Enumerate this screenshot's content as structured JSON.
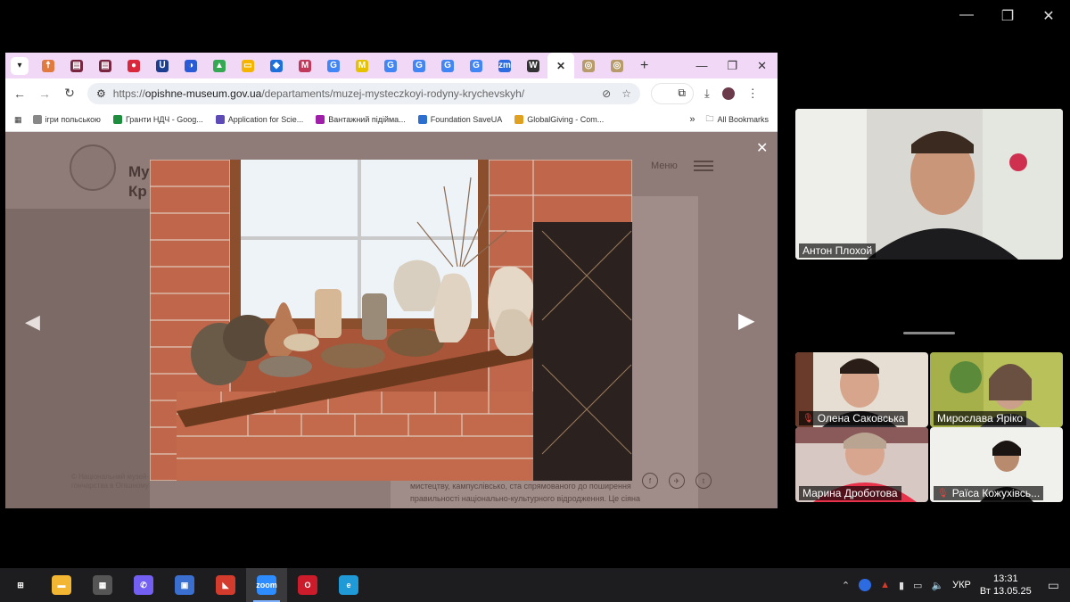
{
  "zoom_window": {
    "controls": [
      "—",
      "❐",
      "✕"
    ]
  },
  "browser": {
    "tabs": [
      {
        "glyph": "☨",
        "color": "#e07a3f"
      },
      {
        "glyph": "▤",
        "color": "#7a2540"
      },
      {
        "glyph": "▤",
        "color": "#7a2540"
      },
      {
        "glyph": "●",
        "color": "#d9283b"
      },
      {
        "glyph": "Ս",
        "color": "#1d3d8f"
      },
      {
        "glyph": "◑",
        "color": "#2a5bd7"
      },
      {
        "glyph": "▲",
        "color": "#34a853"
      },
      {
        "glyph": "▭",
        "color": "#f4b400"
      },
      {
        "glyph": "◆",
        "color": "#1e6fd9"
      },
      {
        "glyph": "M",
        "color": "#c0395a"
      },
      {
        "glyph": "G",
        "color": "#4285f4"
      },
      {
        "glyph": "M",
        "color": "#e5c100"
      },
      {
        "glyph": "G",
        "color": "#4285f4"
      },
      {
        "glyph": "G",
        "color": "#4285f4"
      },
      {
        "glyph": "G",
        "color": "#4285f4"
      },
      {
        "glyph": "G",
        "color": "#4285f4"
      },
      {
        "glyph": "zm",
        "color": "#2d6be0"
      },
      {
        "glyph": "W",
        "color": "#333333"
      }
    ],
    "active_tab_close": "✕",
    "tabs_after": [
      {
        "glyph": "◎",
        "color": "#b89b6a"
      },
      {
        "glyph": "◎",
        "color": "#b89b6a"
      }
    ],
    "new_tab": "+",
    "window_controls": [
      "—",
      "❐",
      "✕"
    ],
    "url": {
      "scheme": "https://",
      "host": "opishne-museum.gov.ua",
      "path": "/departaments/muzej-mystecz​koyi-rodyny-krychevskyh/"
    },
    "bookmarks": [
      {
        "label": "ігри польською",
        "color": "#888888",
        "type": "folder"
      },
      {
        "label": "Гранти НДЧ - Goog...",
        "color": "#1e8e3e"
      },
      {
        "label": "Application for Scie...",
        "color": "#5f4bb6"
      },
      {
        "label": "Вантажний підійма...",
        "color": "#a01fa8"
      },
      {
        "label": "Foundation SaveUA",
        "color": "#2c6fd1"
      },
      {
        "label": "GlobalGiving - Com...",
        "color": "#e0a020"
      }
    ],
    "bookmarks_more": "»",
    "all_bookmarks": "All Bookmarks"
  },
  "page": {
    "title_fragment_1": "Му",
    "title_fragment_2": "Кр",
    "menu_label": "Меню",
    "footer_text_1": "© Національний музей-заповідник",
    "footer_text_2": "гончарства в Опішному",
    "body_text_1": "мистецтву, кампуслівсько, ста спрямованого до поширення",
    "body_text_2": "правильності національно-культурного відродження. Це сіяна",
    "social": [
      "f",
      "✈",
      "t"
    ]
  },
  "lightbox": {
    "close": "✕",
    "prev": "◀",
    "next": "▶"
  },
  "participants": [
    {
      "name": "Антон Плохой",
      "muted": false
    },
    {
      "name": "Олена Саковська",
      "muted": true
    },
    {
      "name": "Мирослава Ярiко",
      "muted": false
    },
    {
      "name": "Марина Дроботова",
      "muted": false
    },
    {
      "name": "Раїса Кожухівсь...",
      "muted": true
    }
  ],
  "taskbar": {
    "apps": [
      {
        "name": "windows-start",
        "glyph": "⊞",
        "color": "#1d1d1f"
      },
      {
        "name": "file-explorer",
        "glyph": "▬",
        "color": "#f2b632"
      },
      {
        "name": "calculator",
        "glyph": "▦",
        "color": "#555555"
      },
      {
        "name": "viber",
        "glyph": "✆",
        "color": "#7360f2"
      },
      {
        "name": "save-app",
        "glyph": "▣",
        "color": "#3a6fcf"
      },
      {
        "name": "chart-app",
        "glyph": "◣",
        "color": "#d33b2c"
      },
      {
        "name": "zoom",
        "glyph": "zoom",
        "color": "#2d8cff"
      },
      {
        "name": "opera",
        "glyph": "O",
        "color": "#cc1b2a"
      },
      {
        "name": "edge",
        "glyph": "e",
        "color": "#1f9ad6"
      }
    ],
    "tray": {
      "chevron": "⌃",
      "lang": "УКР",
      "time": "13:31",
      "date": "Вт 13.05.25",
      "notifications": "▭"
    }
  }
}
